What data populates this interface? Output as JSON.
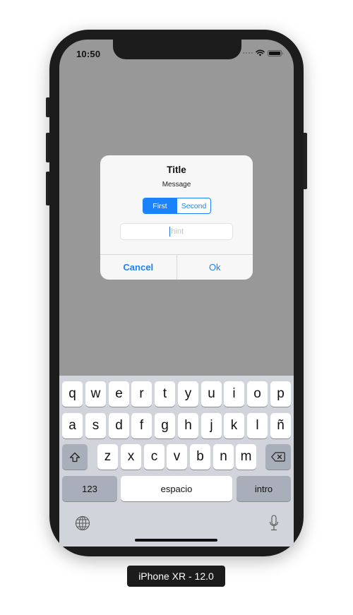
{
  "device": {
    "label": "iPhone XR - 12.0"
  },
  "status_bar": {
    "time": "10:50",
    "icons": [
      "cellular-signal-icon",
      "wifi-icon",
      "battery-icon"
    ]
  },
  "alert": {
    "title": "Title",
    "message": "Message",
    "segmented_control": {
      "options": [
        "First",
        "Second"
      ],
      "selected_index": 0
    },
    "text_field": {
      "value": "",
      "placeholder": "hint"
    },
    "actions": {
      "cancel": "Cancel",
      "ok": "Ok"
    }
  },
  "keyboard": {
    "row1": [
      "q",
      "w",
      "e",
      "r",
      "t",
      "y",
      "u",
      "i",
      "o",
      "p"
    ],
    "row2": [
      "a",
      "s",
      "d",
      "f",
      "g",
      "h",
      "j",
      "k",
      "l",
      "ñ"
    ],
    "row3": [
      "z",
      "x",
      "c",
      "v",
      "b",
      "n",
      "m"
    ],
    "numbers_key": "123",
    "space_key": "espacio",
    "return_key": "intro",
    "icons": [
      "shift-icon",
      "delete-icon",
      "globe-icon",
      "microphone-icon"
    ]
  },
  "colors": {
    "accent": "#1a82fb",
    "dim_background": "#989898",
    "keyboard_background": "#d1d4db",
    "device_frame": "#1c1c1c"
  }
}
